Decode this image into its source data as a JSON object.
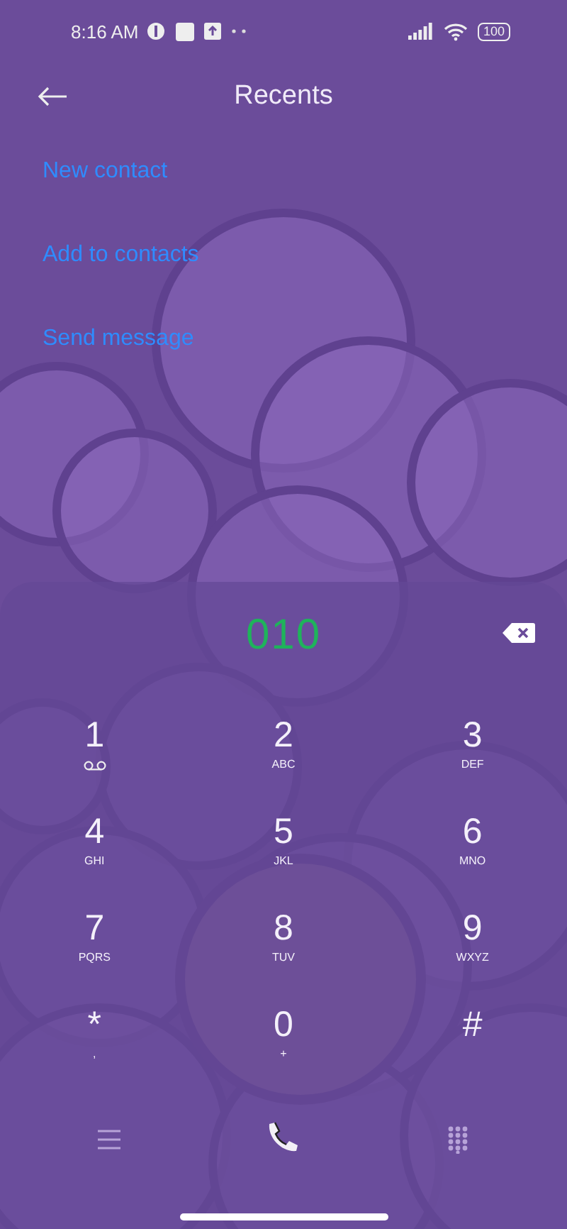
{
  "status_bar": {
    "time": "8:16 AM",
    "battery": "100"
  },
  "header": {
    "title": "Recents"
  },
  "actions": [
    "New contact",
    "Add to contacts",
    "Send message"
  ],
  "dialer": {
    "number": "010"
  },
  "keys": [
    {
      "digit": "1",
      "kind": "voicemail"
    },
    {
      "digit": "2",
      "kind": "letters",
      "letters": "ABC"
    },
    {
      "digit": "3",
      "kind": "letters",
      "letters": "DEF"
    },
    {
      "digit": "4",
      "kind": "letters",
      "letters": "GHI"
    },
    {
      "digit": "5",
      "kind": "letters",
      "letters": "JKL"
    },
    {
      "digit": "6",
      "kind": "letters",
      "letters": "MNO"
    },
    {
      "digit": "7",
      "kind": "letters",
      "letters": "PQRS"
    },
    {
      "digit": "8",
      "kind": "letters",
      "letters": "TUV"
    },
    {
      "digit": "9",
      "kind": "letters",
      "letters": "WXYZ"
    },
    {
      "digit": "*",
      "kind": "letters",
      "letters": ","
    },
    {
      "digit": "0",
      "kind": "letters",
      "letters": "+"
    },
    {
      "digit": "#",
      "kind": "plain"
    }
  ]
}
